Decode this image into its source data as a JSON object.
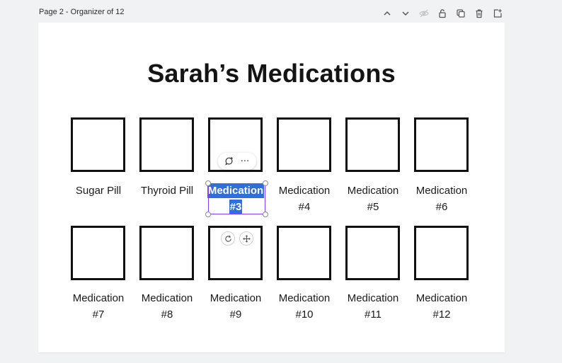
{
  "header": {
    "page_label": "Page 2 - Organizer of 12"
  },
  "toolbar": {
    "icons": [
      "chevron-up-icon",
      "chevron-down-icon",
      "eye-icon",
      "lock-icon",
      "duplicate-icon",
      "trash-icon",
      "add-page-icon"
    ]
  },
  "canvas": {
    "title": "Sarah’s Medications",
    "cells": [
      {
        "line1": "Sugar Pill",
        "line2": ""
      },
      {
        "line1": "Thyroid Pill",
        "line2": ""
      },
      {
        "line1": "Medication",
        "line2": "#3"
      },
      {
        "line1": "Medication",
        "line2": "#4"
      },
      {
        "line1": "Medication",
        "line2": "#5"
      },
      {
        "line1": "Medication",
        "line2": "#6"
      },
      {
        "line1": "Medication",
        "line2": "#7"
      },
      {
        "line1": "Medication",
        "line2": "#8"
      },
      {
        "line1": "Medication",
        "line2": "#9"
      },
      {
        "line1": "Medication",
        "line2": "#10"
      },
      {
        "line1": "Medication",
        "line2": "#11"
      },
      {
        "line1": "Medication",
        "line2": "#12"
      }
    ],
    "selected_index": 2
  },
  "float_bar": {
    "more_label": "···"
  },
  "colors": {
    "selection_highlight": "#2f6fdb",
    "selection_frame": "#8b3dff",
    "border": "#111111"
  }
}
